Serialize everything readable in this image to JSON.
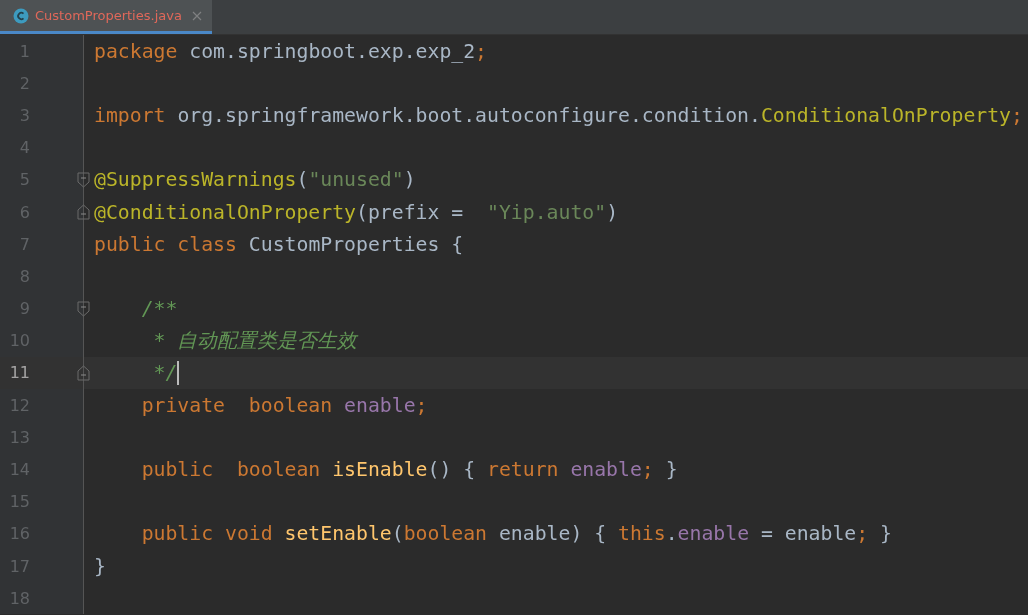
{
  "tabs": [
    {
      "label": "CustomProperties.java",
      "selected": true,
      "error": true
    }
  ],
  "lines": [
    {
      "number": "1",
      "fold_start": false,
      "fold_end": false,
      "current": false,
      "tokens": [
        {
          "text": "package",
          "kind": "keyword"
        },
        {
          "text": " com.springboot.exp.exp_2",
          "kind": "plain"
        },
        {
          "text": ";",
          "kind": "keyword"
        }
      ]
    },
    {
      "number": "2",
      "fold_start": false,
      "fold_end": false,
      "current": false
    },
    {
      "number": "3",
      "fold_start": false,
      "fold_end": false,
      "current": false,
      "tokens": [
        {
          "text": "import",
          "kind": "keyword"
        },
        {
          "text": " org.springframework.boot.autoconfigure.condition.",
          "kind": "plain"
        },
        {
          "text": "ConditionalOnProperty",
          "kind": "annotation"
        },
        {
          "text": ";",
          "kind": "keyword"
        }
      ]
    },
    {
      "number": "4",
      "fold_start": false,
      "fold_end": false,
      "current": false
    },
    {
      "number": "5",
      "fold_start": true,
      "fold_end": false,
      "current": false,
      "tokens": [
        {
          "text": "@SuppressWarnings",
          "kind": "annotation"
        },
        {
          "text": "(",
          "kind": "plain"
        },
        {
          "text": "\"unused\"",
          "kind": "string"
        },
        {
          "text": ")",
          "kind": "plain"
        }
      ]
    },
    {
      "number": "6",
      "fold_start": false,
      "fold_end": true,
      "current": false,
      "tokens": [
        {
          "text": "@ConditionalOnProperty",
          "kind": "annotation"
        },
        {
          "text": "(prefix =  ",
          "kind": "plain"
        },
        {
          "text": "\"Yip.auto\"",
          "kind": "string"
        },
        {
          "text": ")",
          "kind": "plain"
        }
      ]
    },
    {
      "number": "7",
      "fold_start": false,
      "fold_end": false,
      "current": false,
      "tokens": [
        {
          "text": "public class",
          "kind": "keyword"
        },
        {
          "text": " CustomProperties {",
          "kind": "plain"
        }
      ]
    },
    {
      "number": "8",
      "fold_start": false,
      "fold_end": false,
      "current": false
    },
    {
      "number": "9",
      "fold_start": true,
      "fold_end": false,
      "current": false,
      "tokens": [
        {
          "text": "    /**",
          "kind": "comment"
        }
      ]
    },
    {
      "number": "10",
      "fold_start": false,
      "fold_end": false,
      "current": false,
      "tokens": [
        {
          "text": "     * 自动配置类是否生效",
          "kind": "comment"
        }
      ]
    },
    {
      "number": "11",
      "fold_start": false,
      "fold_end": true,
      "current": true,
      "tokens": [
        {
          "text": "     */",
          "kind": "comment"
        }
      ]
    },
    {
      "number": "12",
      "fold_start": false,
      "fold_end": false,
      "current": false,
      "tokens": [
        {
          "text": "    private  boolean",
          "kind": "keyword"
        },
        {
          "text": " enable",
          "kind": "field"
        },
        {
          "text": ";",
          "kind": "keyword"
        }
      ]
    },
    {
      "number": "13",
      "fold_start": false,
      "fold_end": false,
      "current": false
    },
    {
      "number": "14",
      "fold_start": false,
      "fold_end": false,
      "current": false,
      "tokens": [
        {
          "text": "    public  boolean",
          "kind": "keyword"
        },
        {
          "text": " isEnable",
          "kind": "method"
        },
        {
          "text": "() { ",
          "kind": "plain"
        },
        {
          "text": "return",
          "kind": "keyword"
        },
        {
          "text": " enable",
          "kind": "field"
        },
        {
          "text": ";",
          "kind": "keyword"
        },
        {
          "text": " }",
          "kind": "plain"
        }
      ]
    },
    {
      "number": "15",
      "fold_start": false,
      "fold_end": false,
      "current": false
    },
    {
      "number": "16",
      "fold_start": false,
      "fold_end": false,
      "current": false,
      "tokens": [
        {
          "text": "    public void",
          "kind": "keyword"
        },
        {
          "text": " setEnable",
          "kind": "method"
        },
        {
          "text": "(",
          "kind": "plain"
        },
        {
          "text": "boolean",
          "kind": "keyword"
        },
        {
          "text": " enable) { ",
          "kind": "plain"
        },
        {
          "text": "this",
          "kind": "keyword"
        },
        {
          "text": ".",
          "kind": "plain"
        },
        {
          "text": "enable",
          "kind": "field"
        },
        {
          "text": " = enable",
          "kind": "plain"
        },
        {
          "text": ";",
          "kind": "keyword"
        },
        {
          "text": " }",
          "kind": "plain"
        }
      ]
    },
    {
      "number": "17",
      "fold_start": false,
      "fold_end": false,
      "current": false,
      "tokens": [
        {
          "text": "}",
          "kind": "plain"
        }
      ]
    },
    {
      "number": "18",
      "fold_start": false,
      "fold_end": false,
      "current": false
    }
  ]
}
